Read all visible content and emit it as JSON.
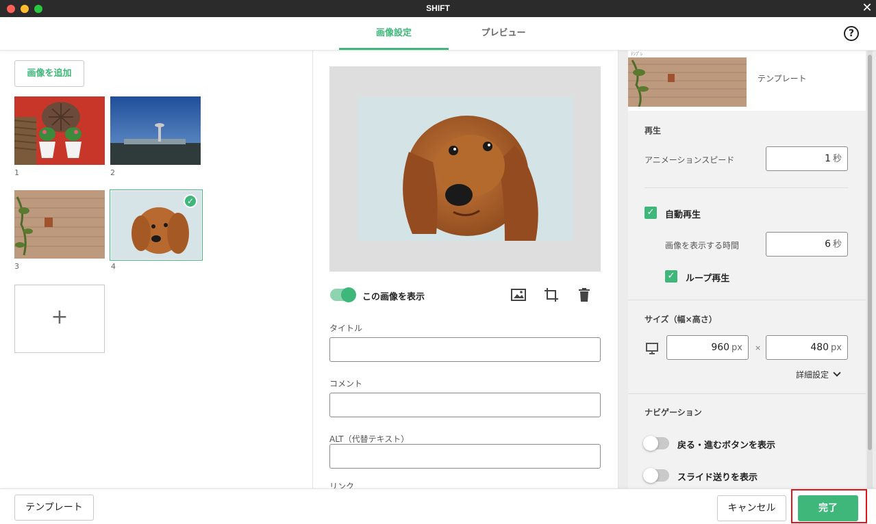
{
  "window": {
    "title": "SHIFT",
    "close_glyph": "✕"
  },
  "tabs": [
    {
      "label": "画像設定",
      "active": true
    },
    {
      "label": "プレビュー",
      "active": false
    }
  ],
  "help_glyph": "?",
  "left": {
    "add_image_label": "画像を追加",
    "thumbnails": [
      {
        "label": "1",
        "subject": "red wall with plants"
      },
      {
        "label": "2",
        "subject": "airport control tower"
      },
      {
        "label": "3",
        "subject": "brick wall with pot"
      },
      {
        "label": "4",
        "subject": "dachshund",
        "selected": true
      }
    ],
    "add_tile_glyph": "+"
  },
  "middle": {
    "show_image_label": "この画像を表示",
    "show_image_on": true,
    "fields": [
      {
        "label": "タイトル",
        "value": ""
      },
      {
        "label": "コメント",
        "value": ""
      },
      {
        "label": "ALT（代替テキスト）",
        "value": ""
      },
      {
        "label": "リンク",
        "value": ""
      }
    ],
    "tool_icons": [
      "image-icon",
      "crop-icon",
      "trash-icon"
    ]
  },
  "right": {
    "template_small_text": "ﾃﾝﾌﾟﾚ",
    "template_name": "テンプレート",
    "playback": {
      "title": "再生",
      "speed_label": "アニメーションスピード",
      "speed_value": "1",
      "speed_unit": "秒",
      "autoplay_label": "自動再生",
      "autoplay_checked": true,
      "display_time_label": "画像を表示する時間",
      "display_time_value": "6",
      "display_time_unit": "秒",
      "loop_label": "ループ再生",
      "loop_checked": true
    },
    "size": {
      "title": "サイズ（幅×高さ）",
      "width_value": "960",
      "height_value": "480",
      "unit": "px",
      "times": "×",
      "advanced_label": "詳細設定"
    },
    "navigation": {
      "title": "ナビゲーション",
      "prev_next_label": "戻る・進むボタンを表示",
      "prev_next_on": false,
      "slide_label": "スライド送りを表示",
      "slide_on": false
    }
  },
  "footer": {
    "template_button": "テンプレート",
    "cancel_button": "キャンセル",
    "done_button": "完了"
  },
  "colors": {
    "accent": "#3fb77a",
    "highlight": "#e0141b"
  }
}
